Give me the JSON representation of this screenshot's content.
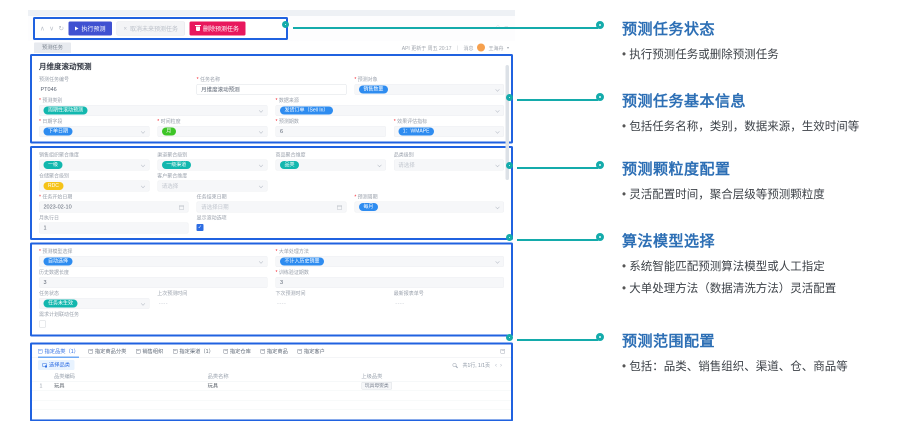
{
  "palette": {
    "teal_connector": "#14ABAB",
    "annotation_blue": "#2D6FB5",
    "highlight_border": "#2062E0",
    "primary_button": "#3F51D1",
    "danger_button": "#E8175D",
    "tag_blue": "#2E8CF0",
    "tag_teal": "#12B7AE",
    "tag_green": "#3EC528",
    "tag_yellow": "#F5C319"
  },
  "window": {
    "tab": "预测任务",
    "api_note": "API 更新于 周五 20:17",
    "separator": "｜",
    "messages": "消息",
    "user": "王海舟",
    "caret": "▾"
  },
  "toolbar": {
    "collapse_up": "∧",
    "collapse_down": "∨",
    "refresh": "↻",
    "execute": "执行预测",
    "cancel": "取消未来预测任务",
    "cancel_x": "×",
    "delete": "删除预测任务",
    "win_circle": "○",
    "win_dash": "–"
  },
  "page_title": "月维度滚动预测",
  "basic": {
    "task_no": {
      "label": "预测任务编号",
      "value": "PT046"
    },
    "task_name": {
      "label": "任务名称",
      "value": "月维度滚动预测"
    },
    "target": {
      "label": "预测对象",
      "value": "销售数量"
    },
    "category": {
      "label": "预测类别",
      "value": "周期性滚动预测"
    },
    "source": {
      "label": "数据来源",
      "value": "发货订单（Sell In）"
    },
    "date_field": {
      "label": "日期字段",
      "value": "下单日期"
    },
    "time_grain": {
      "label": "时间粒度",
      "value": "月"
    },
    "periods": {
      "label": "预测期数",
      "value": "6"
    },
    "metric": {
      "label": "效果评估指标",
      "value": "1：WMAPE"
    }
  },
  "granularity": {
    "org": {
      "label": "销售组织聚合维度",
      "value": "一级"
    },
    "channel": {
      "label": "渠道聚合级别",
      "value": "一级渠道"
    },
    "product": {
      "label": "商品聚合维度",
      "value": "品类"
    },
    "cat_level": {
      "label": "品类级别",
      "placeholder": "请选择"
    },
    "warehouse": {
      "label": "仓储聚合级别",
      "value": "RDC"
    },
    "customer": {
      "label": "客户聚合维度",
      "placeholder": "请选择"
    },
    "start_date": {
      "label": "任务开始日期",
      "value": "2023-02-10"
    },
    "end_date": {
      "label": "任务结束日期",
      "placeholder": "请选择日期"
    },
    "cycle": {
      "label": "预测周期",
      "value": "每月"
    },
    "exec_day": {
      "label": "月执行日",
      "value": "1"
    },
    "rolling": {
      "label": "显示滚动选项",
      "checked": true
    }
  },
  "algorithm": {
    "model": {
      "label": "预测模型选择",
      "value": "自动选择"
    },
    "big_order": {
      "label": "大单处理方法",
      "value": "不计入历史销量"
    },
    "history_len": {
      "label": "历史数据长度",
      "value": "3"
    },
    "validation": {
      "label": "训练验证期数",
      "value": "3"
    },
    "status": {
      "label": "任务状态",
      "value": "任务未生效"
    },
    "last_run": {
      "label": "上次预测时间",
      "value": "----"
    },
    "next_run": {
      "label": "下次预测时间",
      "value": "----"
    },
    "report_no": {
      "label": "最新报表单号",
      "value": "----"
    },
    "linked": {
      "label": "需求计划联动任务",
      "checked": false
    }
  },
  "scope": {
    "tabs": [
      {
        "label": "指定品类（1）"
      },
      {
        "label": "指定商品分类"
      },
      {
        "label": "销售组织"
      },
      {
        "label": "指定渠道（1）"
      },
      {
        "label": "指定仓库"
      },
      {
        "label": "指定商品"
      },
      {
        "label": "指定客户"
      }
    ],
    "select_button": "选择品类",
    "pagination": "共1行, 1/1页",
    "pager_prev": "‹",
    "pager_next": "›",
    "table": {
      "headers": [
        "品类编码",
        "品类名称",
        "上级品类"
      ],
      "rows": [
        {
          "idx": "1",
          "code": "玩具",
          "name": "玩具",
          "parent": "玩具母婴类"
        }
      ]
    }
  },
  "annotations": [
    {
      "title": "预测任务状态",
      "bullets": [
        "执行预测任务或删除预测任务"
      ]
    },
    {
      "title": "预测任务基本信息",
      "bullets": [
        "包括任务名称，类别，数据来源，生效时间等"
      ]
    },
    {
      "title": "预测颗粒度配置",
      "bullets": [
        "灵活配置时间，聚合层级等预测颗粒度"
      ]
    },
    {
      "title": "算法模型选择",
      "bullets": [
        "系统智能匹配预测算法模型或人工指定",
        "大单处理方法（数据清洗方法）灵活配置"
      ]
    },
    {
      "title": "预测范围配置",
      "bullets": [
        "包括：品类、销售组织、渠道、仓、商品等"
      ]
    }
  ]
}
